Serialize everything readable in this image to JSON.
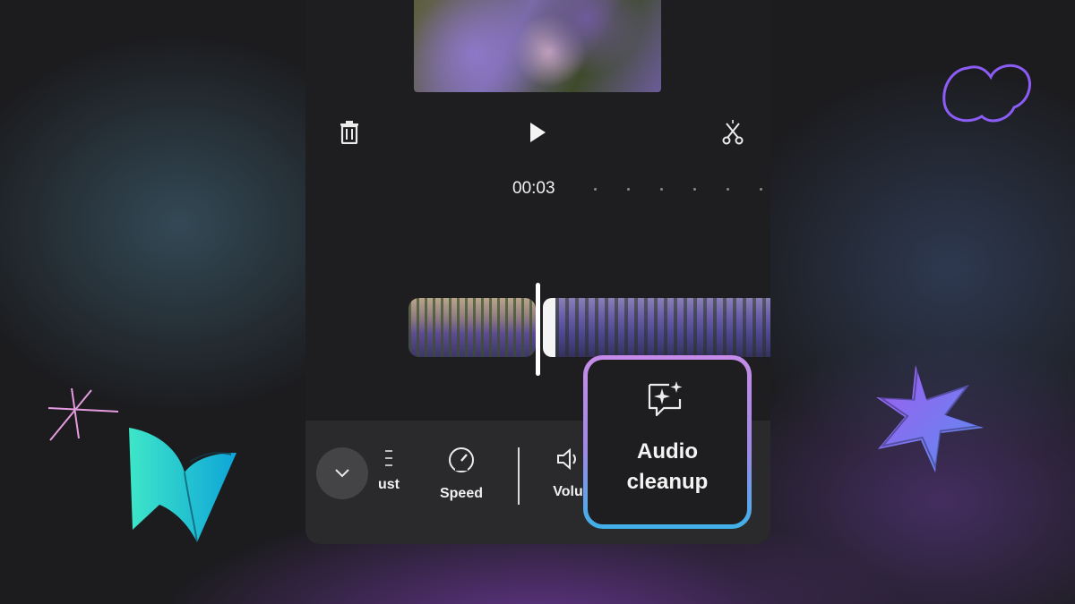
{
  "editor": {
    "timecode": "00:03",
    "tools": {
      "adjust_partial": "ust",
      "speed": "Speed",
      "volume_partial": "Volu"
    },
    "feature_card": {
      "title_line1": "Audio",
      "title_line2": "cleanup"
    }
  },
  "icons": {
    "delete": "trash-icon",
    "play": "play-icon",
    "split": "scissors-icon",
    "collapse": "chevron-down-icon",
    "speed": "speedometer-icon",
    "volume": "speaker-icon",
    "audio_cleanup": "chat-sparkle-icon"
  },
  "colors": {
    "card_gradient_top": "#c58ce8",
    "card_gradient_bottom": "#3fb0e8",
    "accent_purple": "#8b5cf6",
    "accent_teal": "#2dd4bf"
  }
}
